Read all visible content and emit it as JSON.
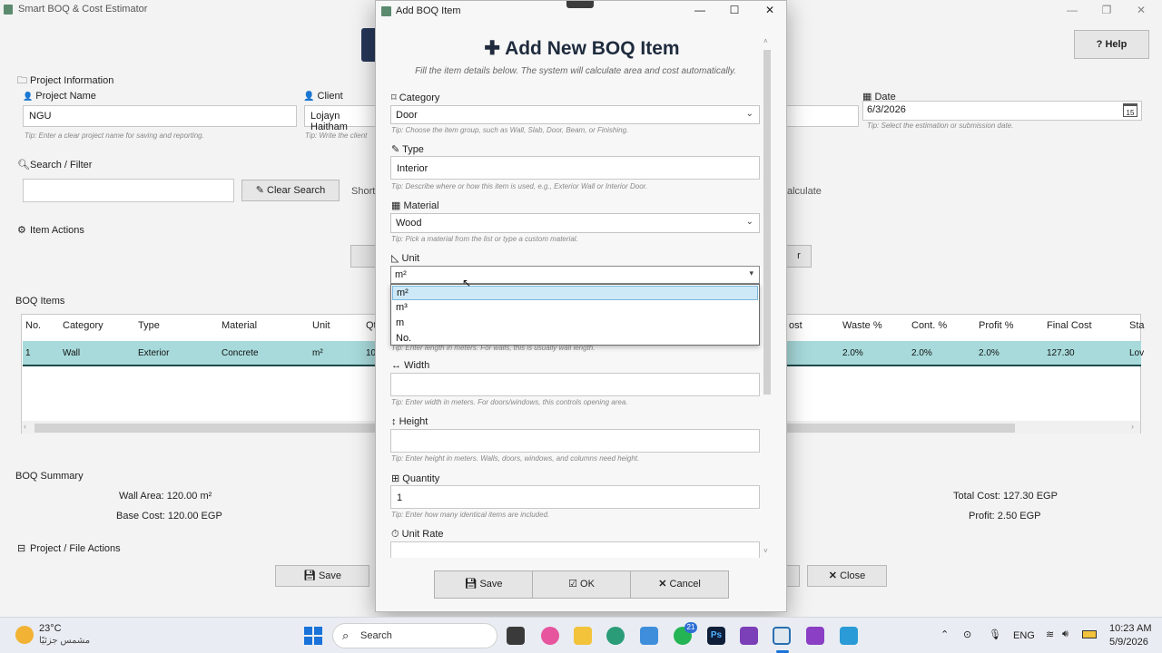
{
  "app": {
    "title": "Smart BOQ & Cost Estimator",
    "help_label": "Help",
    "project_info": {
      "title": "Project Information",
      "project_name_label": "Project Name",
      "project_name_value": "NGU",
      "project_name_tip": "Tip: Enter a clear project name for saving and reporting.",
      "client_label": "Client",
      "client_value": "Lojayn Haitham",
      "client_tip": "Tip: Write the client",
      "date_label": "Date",
      "date_value": "6/3/2026",
      "date_tip": "Tip: Select the estimation or submission date.",
      "calendar_day": "15"
    },
    "search": {
      "title": "Search / Filter",
      "value": "",
      "clear_label": "Clear Search",
      "shortcut_fragment": "Shortc",
      "calculate_fragment": "alculate"
    },
    "item_actions": {
      "title": "Item Actions",
      "right_button_fragment": "r"
    },
    "boq_items": {
      "title": "BOQ Items",
      "columns_left": [
        "No.",
        "Category",
        "Type",
        "Material",
        "Unit",
        "Qt"
      ],
      "columns_right": [
        "ost",
        "Waste %",
        "Cont. %",
        "Profit %",
        "Final Cost",
        "Sta"
      ],
      "rows": [
        {
          "left": [
            "1",
            "Wall",
            "Exterior",
            "Concrete",
            "m²",
            "10"
          ],
          "right": [
            "",
            "2.0%",
            "2.0%",
            "2.0%",
            "127.30",
            "Lov"
          ]
        }
      ]
    },
    "summary": {
      "title": "BOQ Summary",
      "wall_area": "Wall Area: 120.00 m²",
      "base_cost": "Base Cost: 120.00 EGP",
      "total_cost": "Total Cost: 127.30 EGP",
      "profit": "Profit: 2.50 EGP"
    },
    "file_actions": {
      "title": "Project / File Actions",
      "save_label": "Save",
      "close_label": "Close"
    }
  },
  "dialog": {
    "window_title": "Add BOQ Item",
    "heading": "Add New BOQ Item",
    "subtitle": "Fill the item details below. The system will calculate area and cost automatically.",
    "category": {
      "label": "Category",
      "value": "Door",
      "tip": "Tip: Choose the item group, such as Wall, Slab, Door, Beam, or Finishing."
    },
    "type": {
      "label": "Type",
      "value": "Interior",
      "tip": "Tip: Describe where or how this item is used, e.g., Exterior Wall or Interior Door."
    },
    "material": {
      "label": "Material",
      "value": "Wood",
      "tip": "Tip: Pick a material from the list or type a custom material."
    },
    "unit": {
      "label": "Unit",
      "value": "m²",
      "options": [
        "m²",
        "m³",
        "m",
        "No."
      ],
      "selected_index": 0,
      "hidden_tip_fragment": "Tip: Enter length in meters. For walls, this is usually wall length."
    },
    "width": {
      "label": "Width",
      "value": "",
      "tip": "Tip: Enter width in meters. For doors/windows, this controls opening area."
    },
    "height": {
      "label": "Height",
      "value": "",
      "tip": "Tip: Enter height in meters. Walls, doors, windows, and columns need height."
    },
    "quantity": {
      "label": "Quantity",
      "value": "1",
      "tip": "Tip: Enter how many identical items are included."
    },
    "unit_rate": {
      "label": "Unit Rate",
      "value": ""
    },
    "buttons": {
      "save": "Save",
      "ok": "OK",
      "cancel": "Cancel"
    }
  },
  "taskbar": {
    "weather_temp": "23°C",
    "weather_desc": "مشمس جزئيًا",
    "search_placeholder": "Search",
    "whatsapp_badge": "21",
    "language": "ENG",
    "time": "10:23 AM",
    "date": "5/9/2026"
  },
  "colors": {
    "selected_row": "#a8dadb",
    "dialog_heading": "#1f2b3d",
    "dropdown_selected": "#cde8f7"
  }
}
